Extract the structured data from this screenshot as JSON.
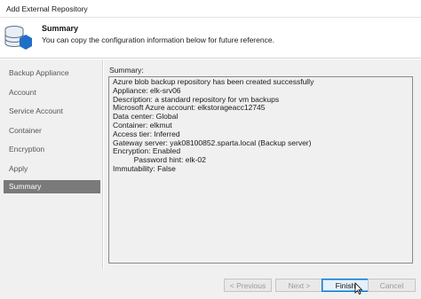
{
  "window": {
    "title": "Add External Repository"
  },
  "header": {
    "title": "Summary",
    "subtitle": "You can copy the configuration information below for future reference."
  },
  "sidebar": {
    "steps": [
      {
        "label": "Backup Appliance",
        "active": false
      },
      {
        "label": "Account",
        "active": false
      },
      {
        "label": "Service Account",
        "active": false
      },
      {
        "label": "Container",
        "active": false
      },
      {
        "label": "Encryption",
        "active": false
      },
      {
        "label": "Apply",
        "active": false
      },
      {
        "label": "Summary",
        "active": true
      }
    ]
  },
  "summary": {
    "label": "Summary:",
    "lines": [
      "Azure blob backup repository has been created successfully",
      "Appliance: elk-srv06",
      "Description: a standard repository for vm backups",
      "Microsoft Azure account: elkstorageacc12745",
      "Data center: Global",
      "Container: elkmut",
      "Access tier: Inferred",
      "Gateway server: yak08100852.sparta.local (Backup server)",
      "Encryption: Enabled",
      "          Password hint: elk-02",
      "Immutability: False"
    ]
  },
  "footer": {
    "previous_label": "< Previous",
    "next_label": "Next >",
    "finish_label": "Finish",
    "cancel_label": "Cancel"
  },
  "colors": {
    "icon_blue": "#1f6fc7",
    "active_step": "#7a7a7a",
    "primary_border": "#0078d7"
  }
}
